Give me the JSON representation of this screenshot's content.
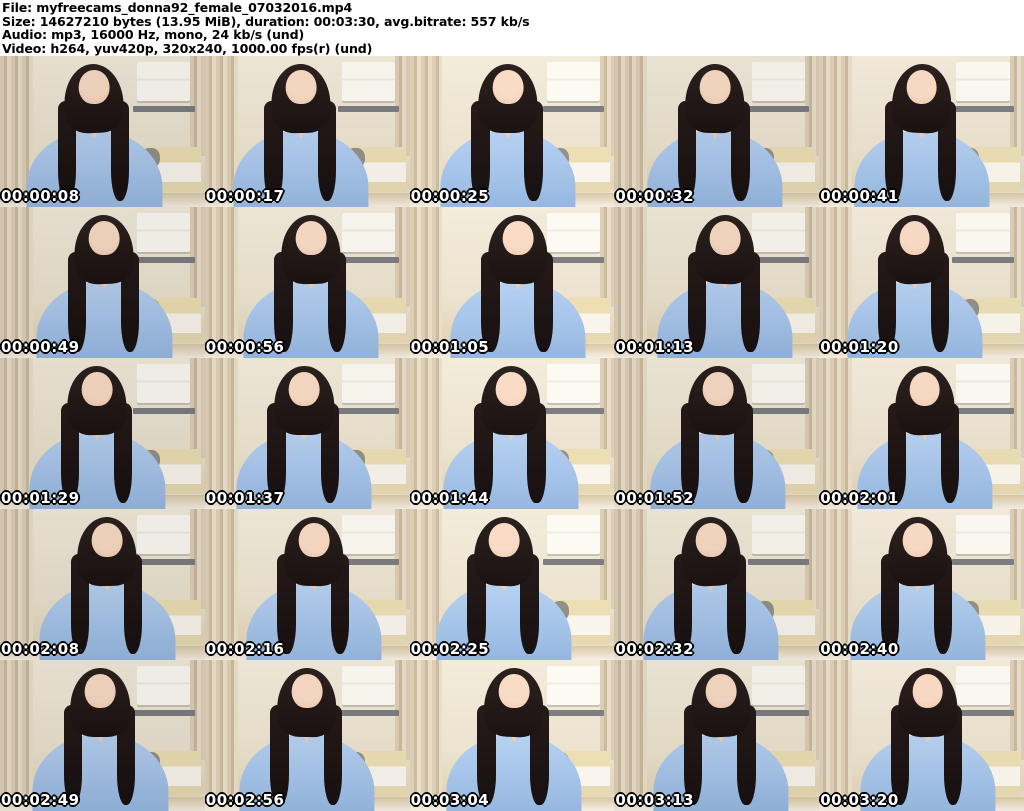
{
  "header": {
    "lines": [
      "File: myfreecams_donna92_female_07032016.mp4",
      "Size: 14627210 bytes (13.95 MiB), duration: 00:03:30, avg.bitrate: 557 kb/s",
      "Audio: mp3, 16000 Hz, mono, 24 kb/s (und)",
      "Video: h264, yuv420p, 320x240, 1000.00 fps(r) (und)"
    ]
  },
  "grid": {
    "columns": 5,
    "rows": 5,
    "timestamps": [
      "00:00:08",
      "00:00:17",
      "00:00:25",
      "00:00:32",
      "00:00:41",
      "00:00:49",
      "00:00:56",
      "00:01:05",
      "00:01:13",
      "00:01:20",
      "00:01:29",
      "00:01:37",
      "00:01:44",
      "00:01:52",
      "00:02:01",
      "00:02:08",
      "00:02:16",
      "00:02:25",
      "00:02:32",
      "00:02:40",
      "00:02:49",
      "00:02:56",
      "00:03:04",
      "00:03:13",
      "00:03:20"
    ]
  },
  "colors": {
    "header_text": "#000000",
    "page_background": "#ffffff",
    "timestamp_text": "#ffffff",
    "timestamp_outline": "#000000",
    "scene_wall": "#e7dfcc",
    "scene_curtain": "#d3c5ac",
    "scene_shirt": "#a4c1e4",
    "scene_hair": "#1e1513",
    "scene_skin": "#eecab4",
    "scene_bed_sheet": "#f2eee5",
    "scene_headboard": "#e2d4ac"
  }
}
